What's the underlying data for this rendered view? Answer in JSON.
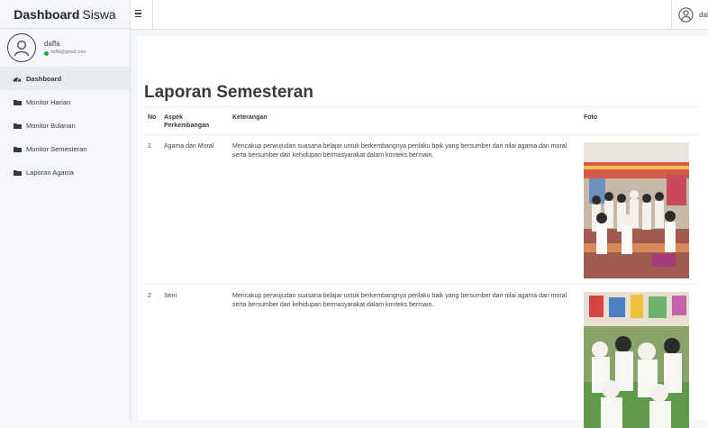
{
  "brand": {
    "bold": "Dashboard",
    "light": "Siswa"
  },
  "user": {
    "name": "daffa",
    "email": "daffa@gmail.com",
    "status_color": "#28a745"
  },
  "sidebar": {
    "items": [
      {
        "label": "Dashboard",
        "icon": "tachometer-icon",
        "active": true
      },
      {
        "label": "Monitor Harian",
        "icon": "folder-icon"
      },
      {
        "label": "Monitor Bulanan",
        "icon": "folder-icon"
      },
      {
        "label": "Monitor Semesteran",
        "icon": "folder-icon"
      },
      {
        "label": "Laporan Agama",
        "icon": "folder-icon"
      }
    ]
  },
  "topbar": {
    "menu_icon": "hamburger-icon",
    "user_label": "daffa",
    "user_icon": "user-circle-icon"
  },
  "main": {
    "title": "Laporan Semesteran",
    "table": {
      "headers": [
        "No",
        "Aspek Perkembangan",
        "Keterangan",
        "Foto"
      ],
      "rows": [
        {
          "no": "1",
          "aspek": "Agama dan Moral",
          "keterangan": "Mencakup perwujudan suasana belajar untuk berkembangnya perilaku baik yang bersumber dari nilai agama dan moral serta bersumber dari kehidupan bermasyarakat dalam konteks bermain.",
          "foto": "photo-children-praying"
        },
        {
          "no": "2",
          "aspek": "Seni",
          "keterangan": "Mencakup perwujudan suasana belajar untuk berkembangnya perilaku baik yang bersumber dari nilai agama dan moral serta bersumber dari kehidupan bermasyarakat dalam konteks bermain.",
          "foto": "photo-children-classroom"
        }
      ]
    }
  }
}
